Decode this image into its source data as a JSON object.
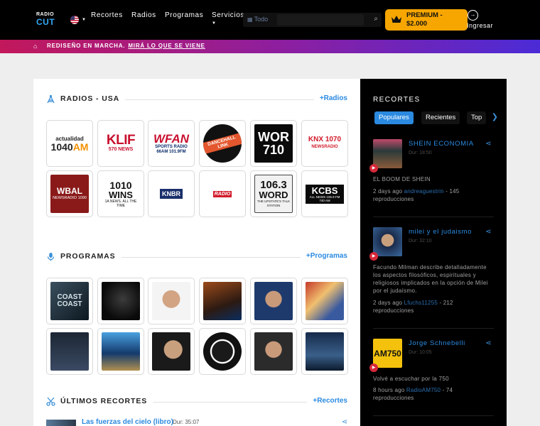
{
  "header": {
    "logo_top": "RADIO",
    "logo_bottom": "CUT",
    "nav": [
      {
        "label": "Recortes"
      },
      {
        "label": "Radios"
      },
      {
        "label": "Programas"
      },
      {
        "label": "Servicios"
      }
    ],
    "search_scope": "Todo",
    "premium_label": "PREMIUM - $2.000",
    "login_label": "Ingresar"
  },
  "banner": {
    "text": "REDISEÑO EN MARCHA.",
    "link": "MIRÁ LO QUE SE VIENE"
  },
  "radios": {
    "title": "RADIOS - USA",
    "more": "+Radios",
    "items": [
      {
        "l1": "actualidad",
        "l2": "1040",
        "l2b": "AM"
      },
      {
        "l1": "KLIF",
        "l2": "570 NEWS"
      },
      {
        "l1": "WFAN",
        "l2": "SPORTS RADIO 66AM 101.9FM"
      },
      {
        "l1": "DANCEHALL LINK"
      },
      {
        "l1": "WOR",
        "l2": "710"
      },
      {
        "l1": "KNX 1070",
        "l2": "NEWSRADIO"
      },
      {
        "l1": "WBAL",
        "l2": "NEWSRADIO 1090"
      },
      {
        "l1": "1010",
        "l2": "WINS",
        "l3": "1A NEWS. ALL THE TIME"
      },
      {
        "l1": "KNBR"
      },
      {
        "l1": "RADIO"
      },
      {
        "l1": "106.3",
        "l2": "WORD",
        "l3": "THE UPSTATE'S TALK STATION"
      },
      {
        "l1": "KCBS",
        "l2": "ALL NEWS 106.9 FM 740 AM"
      }
    ]
  },
  "programs": {
    "title": "PROGRAMAS",
    "more": "+Programas",
    "first_label": "COAST COAST"
  },
  "clips": {
    "title": "ÚLTIMOS RECORTES",
    "more": "+Recortes",
    "first_title": "Las fuerzas del cielo (libro)",
    "first_duration": "Dur: 35:07"
  },
  "sidebar": {
    "title": "RECORTES",
    "tabs": [
      "Populares",
      "Recientes",
      "Top"
    ],
    "cards": [
      {
        "name": "SHEIN ECONOMIA",
        "duration": "Dur: 18:50",
        "description": "EL BOOM DE SHEIN",
        "time": "2 days ago",
        "user": "andreaguestrin",
        "plays": "145 reproducciones"
      },
      {
        "name": "milei y el judaismo",
        "duration": "Dur: 32:10",
        "description": "Facundo Milman describe detalladamente los aspectos filosóficos, espirituales y religiosos implicados en la opción de Milei por el judaísmo.",
        "time": "2 days ago",
        "user": "Lfuchs11255",
        "plays": "212 reproducciones"
      },
      {
        "name": "Jorge Schnebelli",
        "duration": "Dur: 10:05",
        "logo_text": "AM750",
        "description": "Volvé a escuchar por la 750",
        "time": "8 hours ago",
        "user": "RadioAM750",
        "plays": "74 reproducciones"
      }
    ]
  },
  "colors": {
    "accent": "#2b8ae0",
    "premium": "#f7a600",
    "banner_start": "#c2185b",
    "banner_end": "#4b2bd6"
  }
}
